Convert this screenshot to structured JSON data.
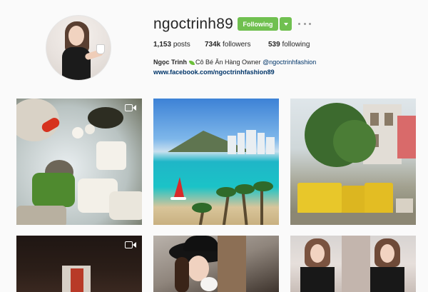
{
  "profile": {
    "username": "ngoctrinh89",
    "follow_label": "Following",
    "stats": {
      "posts_count": "1,153",
      "posts_label": "posts",
      "followers_count": "734k",
      "followers_label": "followers",
      "following_count": "539",
      "following_label": "following"
    },
    "bio": {
      "name": "Ngọc Trinh",
      "text": "Cô Bé Ăn Hàng Owner ",
      "mention": "@ngoctrinhfashion"
    },
    "link": "www.facebook.com/ngoctrinhfashion89"
  },
  "colors": {
    "follow_button": "#70c050",
    "link": "#003569",
    "background": "#fafafa"
  },
  "grid": {
    "posts": [
      {
        "kind": "video",
        "icon": "video-camera-icon",
        "subject": "hotpot"
      },
      {
        "kind": "photo",
        "subject": "beach"
      },
      {
        "kind": "photo",
        "subject": "street"
      },
      {
        "kind": "video",
        "icon": "video-camera-icon",
        "subject": "dark-portrait"
      },
      {
        "kind": "photo",
        "subject": "hat-portrait"
      },
      {
        "kind": "photo",
        "subject": "dress-portraits"
      }
    ]
  }
}
